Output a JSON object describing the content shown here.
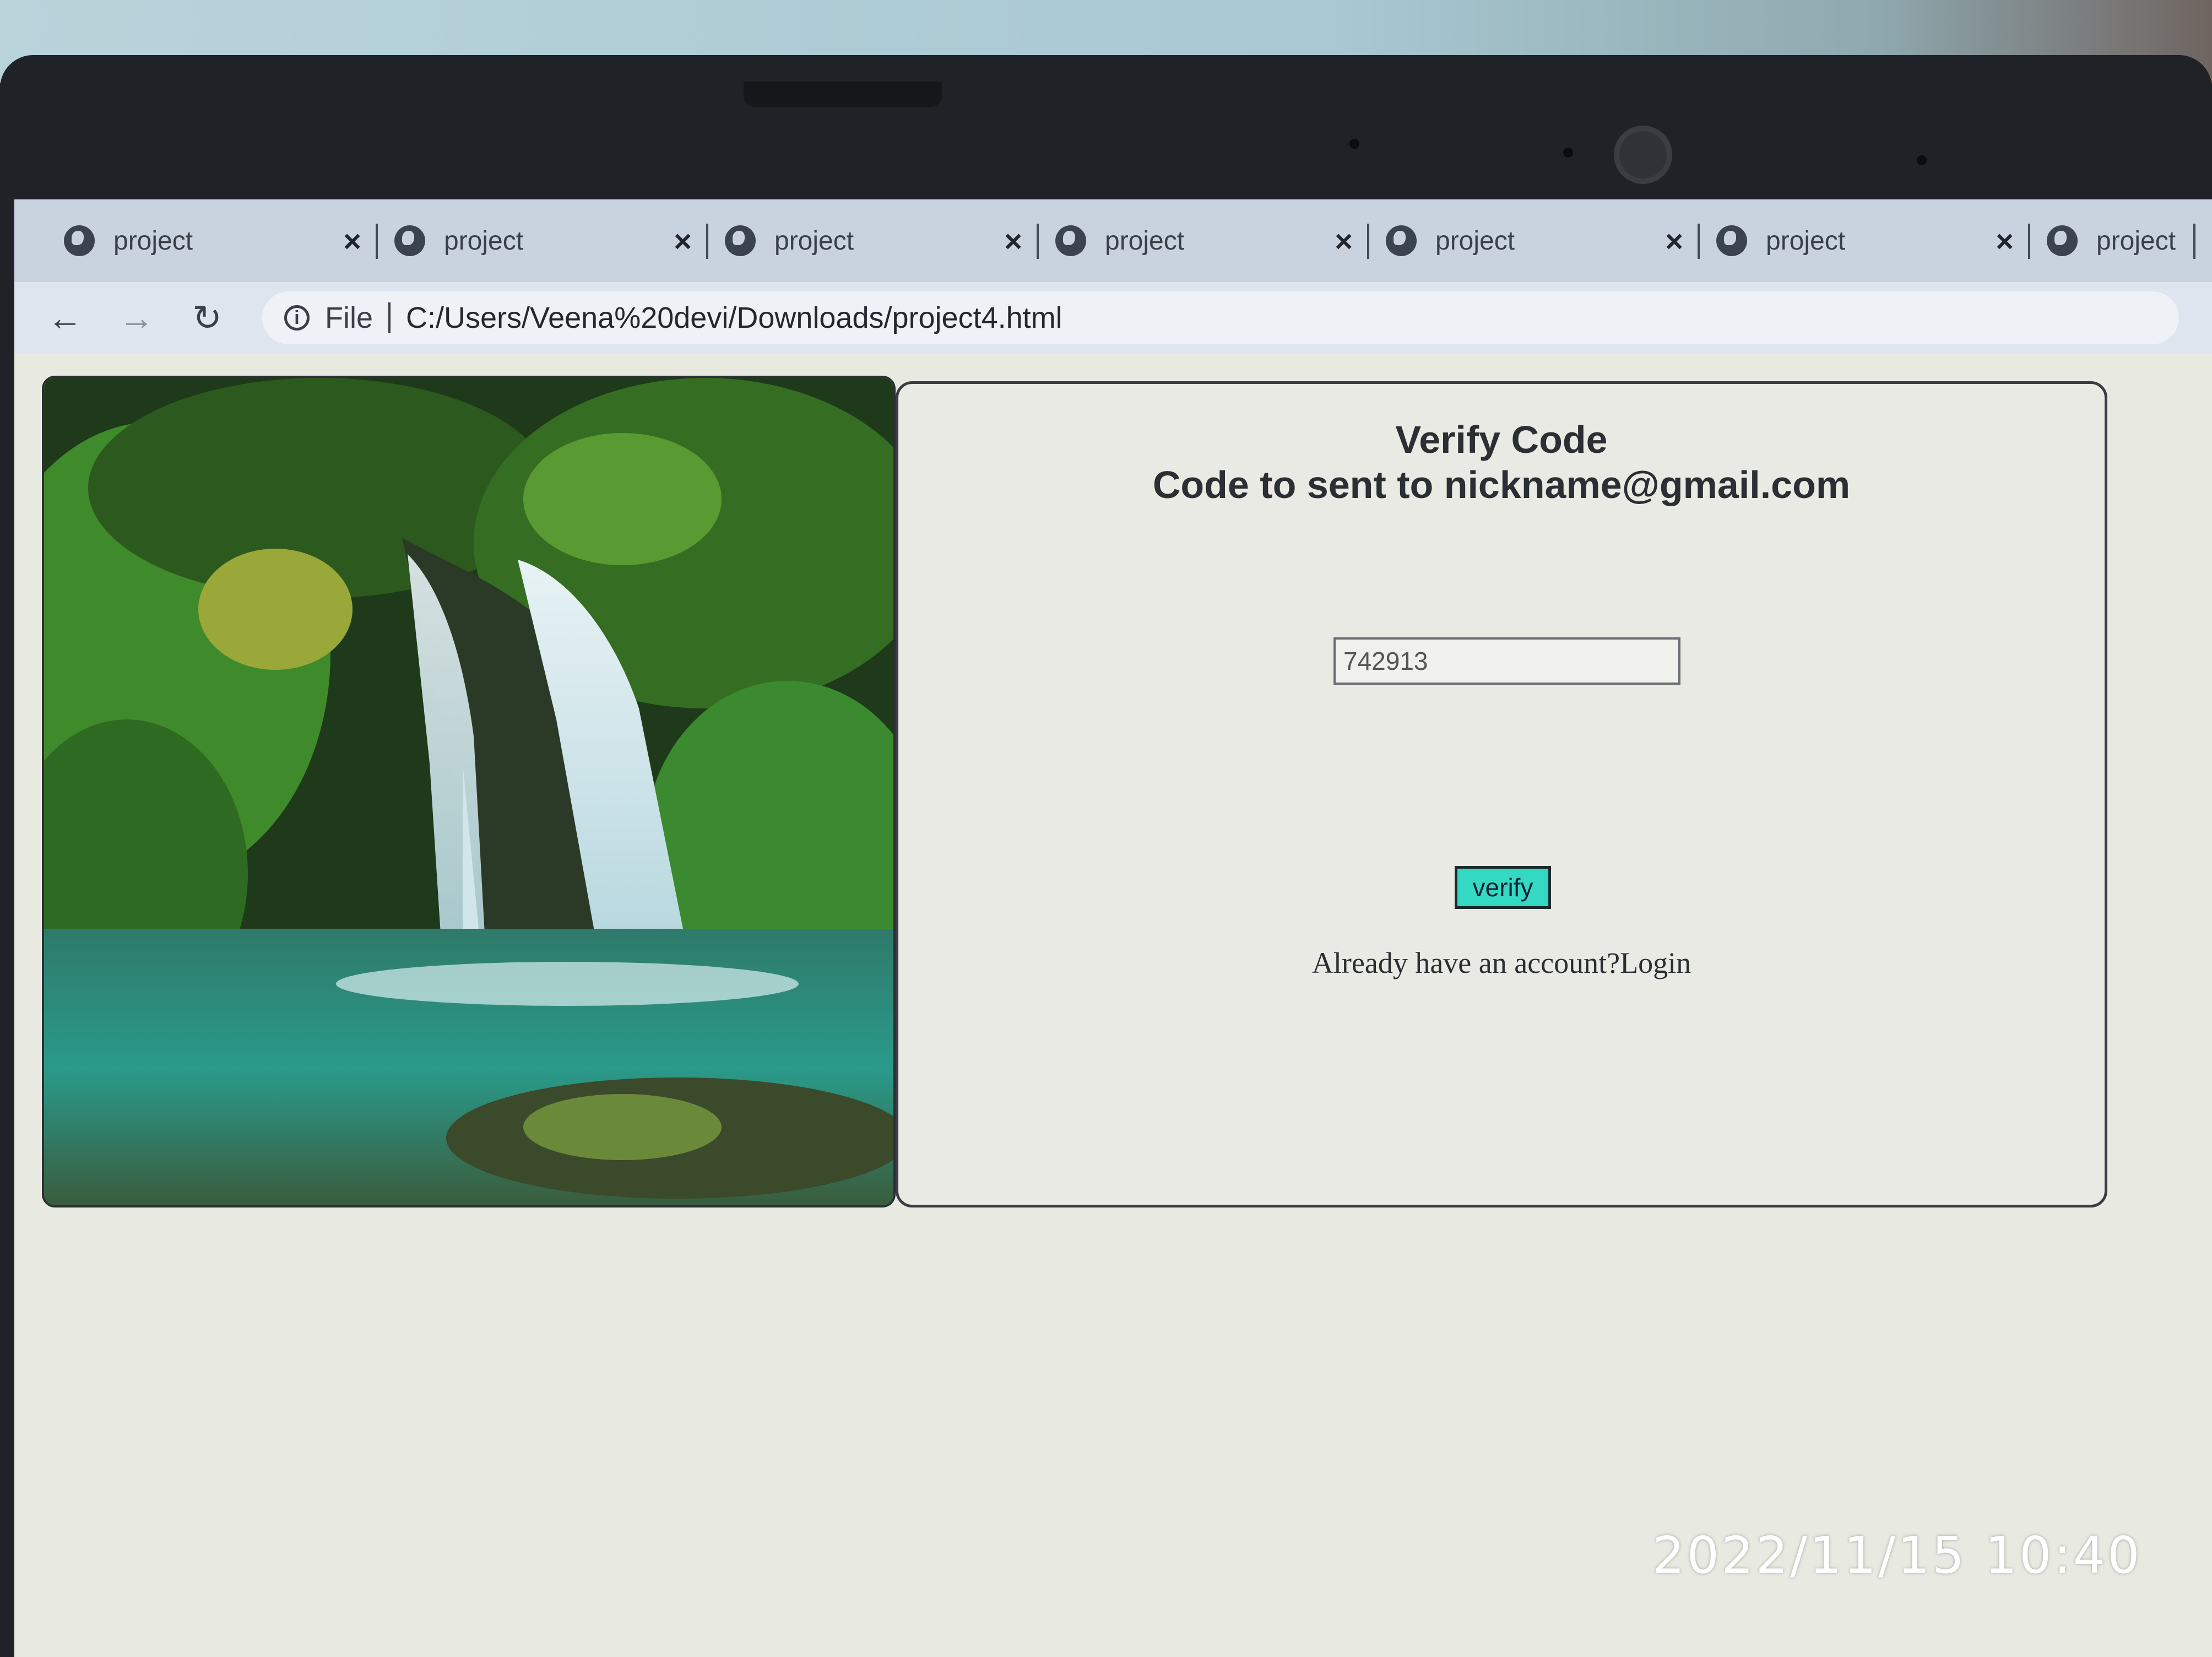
{
  "browser": {
    "tabs": [
      {
        "label": "project",
        "close": "×"
      },
      {
        "label": "project",
        "close": "×"
      },
      {
        "label": "project",
        "close": "×"
      },
      {
        "label": "project",
        "close": "×"
      },
      {
        "label": "project",
        "close": "×"
      },
      {
        "label": "project",
        "close": "×"
      },
      {
        "label": "project",
        "close": ""
      }
    ],
    "nav": {
      "back": "←",
      "forward": "→",
      "reload": "↻"
    },
    "address": {
      "info": "i",
      "scheme_label": "File",
      "url": "C:/Users/Veena%20devi/Downloads/project4.html"
    }
  },
  "form": {
    "title_line1": "Verify Code",
    "title_line2": "Code to sent to nickname@gmail.com",
    "code_value": "742913",
    "verify_label": "verify",
    "login_prompt": "Already have an account?Login"
  },
  "photo_timestamp": "2022/11/15  10:40",
  "colors": {
    "verify_button": "#34d9c4",
    "page_bg": "#e8e9e1",
    "tabstrip": "#c9d3e0"
  }
}
